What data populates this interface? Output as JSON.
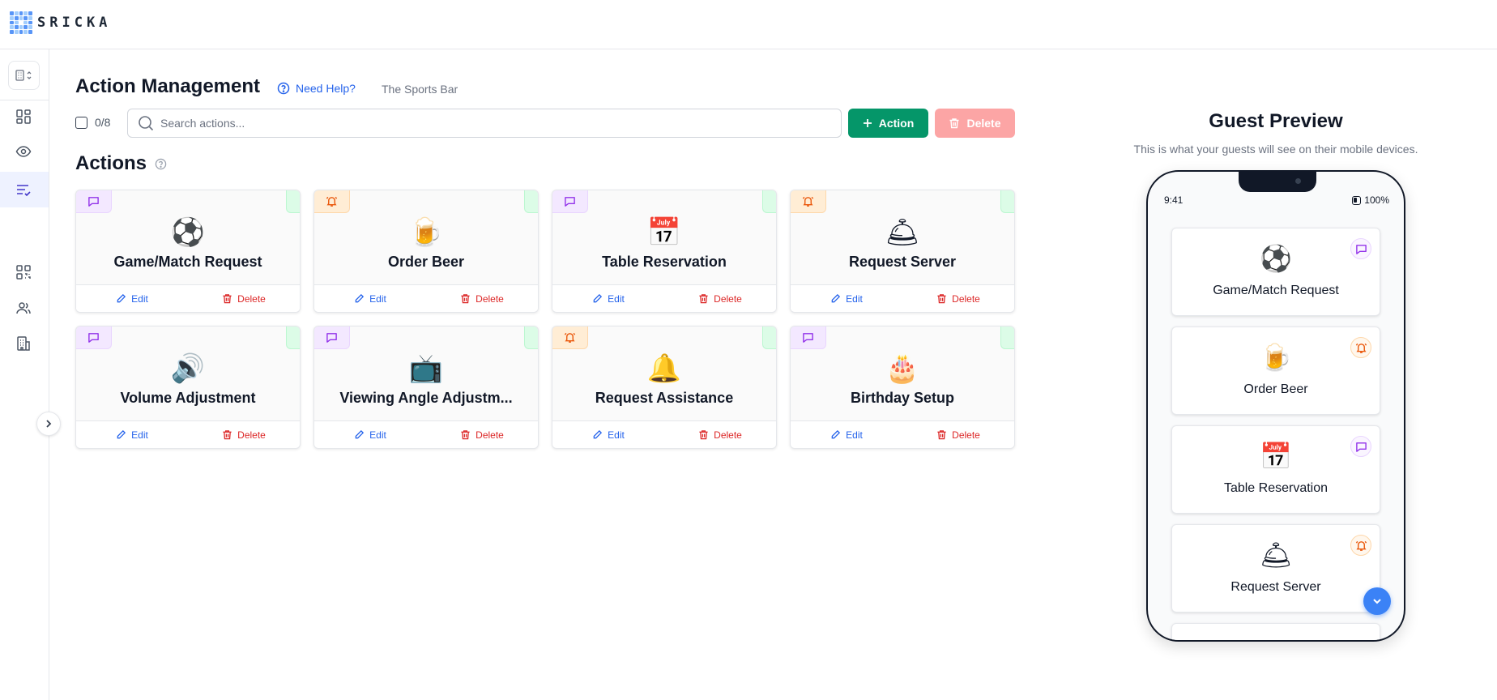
{
  "app": {
    "logo_text": "SRICKA"
  },
  "header": {
    "title": "Action Management",
    "help_label": "Need Help?",
    "venue": "The Sports Bar"
  },
  "toolbar": {
    "selection_count": "0/8",
    "search_placeholder": "Search actions...",
    "add_label": "Action",
    "delete_label": "Delete"
  },
  "section": {
    "title": "Actions"
  },
  "actions": [
    {
      "name": "Game/Match Request",
      "emoji": "⚽",
      "type": "message",
      "edit_label": "Edit",
      "delete_label": "Delete"
    },
    {
      "name": "Order Beer",
      "emoji": "🍺",
      "type": "alert",
      "edit_label": "Edit",
      "delete_label": "Delete"
    },
    {
      "name": "Table Reservation",
      "emoji": "📅",
      "type": "message",
      "edit_label": "Edit",
      "delete_label": "Delete"
    },
    {
      "name": "Request Server",
      "emoji": "🛎",
      "type": "alert",
      "edit_label": "Edit",
      "delete_label": "Delete"
    },
    {
      "name": "Volume Adjustment",
      "emoji": "🔊",
      "type": "message",
      "edit_label": "Edit",
      "delete_label": "Delete"
    },
    {
      "name": "Viewing Angle Adjustm...",
      "emoji": "📺",
      "type": "message",
      "edit_label": "Edit",
      "delete_label": "Delete"
    },
    {
      "name": "Request Assistance",
      "emoji": "🔔",
      "type": "alert",
      "edit_label": "Edit",
      "delete_label": "Delete"
    },
    {
      "name": "Birthday Setup",
      "emoji": "🎂",
      "type": "message",
      "edit_label": "Edit",
      "delete_label": "Delete"
    }
  ],
  "preview": {
    "title": "Guest Preview",
    "subtitle": "This is what your guests will see on their mobile devices.",
    "time": "9:41",
    "battery": "100%",
    "items": [
      {
        "name": "Game/Match Request",
        "emoji": "⚽",
        "type": "message"
      },
      {
        "name": "Order Beer",
        "emoji": "🍺",
        "type": "alert"
      },
      {
        "name": "Table Reservation",
        "emoji": "📅",
        "type": "message"
      },
      {
        "name": "Request Server",
        "emoji": "🛎",
        "type": "alert"
      }
    ]
  },
  "icons": {
    "sidebar": [
      "dashboard-icon",
      "eye-icon",
      "list-check-icon",
      "qr-code-icon",
      "users-icon",
      "building-icon"
    ],
    "type_message": "message-square-icon",
    "type_alert": "bell-ring-icon"
  },
  "colors": {
    "primary_green": "#059669",
    "danger": "#dc2626",
    "danger_disabled": "#fca5a5",
    "link_blue": "#2563eb",
    "message_purple": "#9333ea",
    "alert_orange": "#ea580c",
    "status_green": "#dcfce7",
    "scroll_blue": "#3b82f6"
  }
}
